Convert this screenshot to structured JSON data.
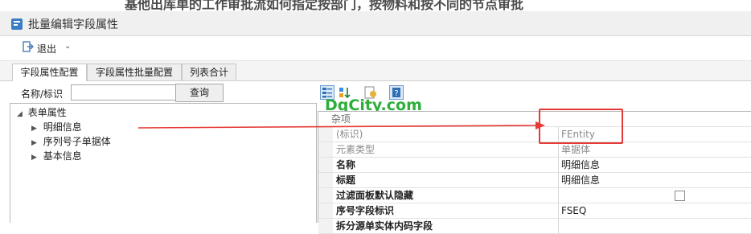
{
  "background_heading": "基他出库单的工作审批流如何指定按部门，按物料和按不同的节点审批",
  "window": {
    "title": "批量编辑字段属性"
  },
  "toolbar": {
    "exit_label": "退出"
  },
  "tabs": [
    {
      "label": "字段属性配置",
      "active": true
    },
    {
      "label": "字段属性批量配置",
      "active": false
    },
    {
      "label": "列表合计",
      "active": false
    }
  ],
  "search": {
    "label": "名称/标识",
    "value": "",
    "button_label": "查询"
  },
  "tree": {
    "root": "表单属性",
    "children": [
      {
        "label": "明细信息",
        "selected": true
      },
      {
        "label": "序列号子单据体",
        "selected": false
      },
      {
        "label": "基本信息",
        "selected": false
      }
    ]
  },
  "grid_toolbar_icons": [
    "categorized-view-icon",
    "sort-icon",
    "property-page-icon",
    "help-icon"
  ],
  "watermark": "DqCity.com",
  "property_grid": {
    "category": "杂项",
    "rows": [
      {
        "name": "(标识)",
        "value": "FEntity",
        "style": "readonly"
      },
      {
        "name": "元素类型",
        "value": "单据体",
        "style": "readonly"
      },
      {
        "name": "名称",
        "value": "明细信息",
        "style": "bold"
      },
      {
        "name": "标题",
        "value": "明细信息",
        "style": "bold"
      },
      {
        "name": "过滤面板默认隐藏",
        "value": "",
        "style": "bold",
        "checkbox": true
      },
      {
        "name": "序号字段标识",
        "value": "FSEQ",
        "style": "bold"
      },
      {
        "name": "拆分源单实体内码字段",
        "value": "",
        "style": "bold"
      }
    ]
  },
  "colors": {
    "annotation": "#e53935",
    "watermark": "#2eae3a",
    "tab_border": "#c8c8c8"
  }
}
